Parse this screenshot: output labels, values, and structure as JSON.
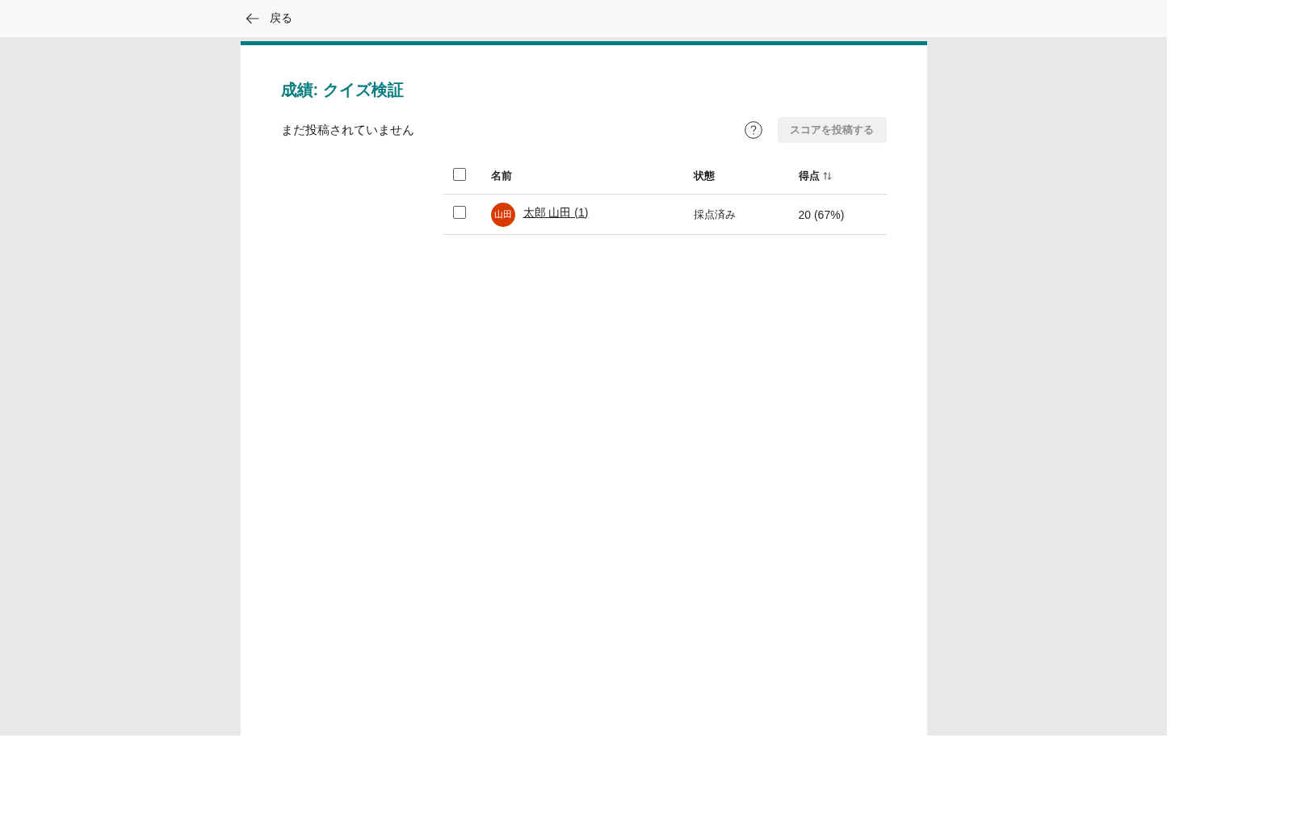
{
  "topbar": {
    "back_label": "戻る"
  },
  "page": {
    "title": "成績: クイズ検証",
    "status_text": "まだ投稿されていません",
    "post_button": {
      "label": "スコアを投稿する",
      "disabled": true
    }
  },
  "table": {
    "select_all": {
      "checked": false
    },
    "columns": [
      {
        "label": "名前",
        "sortable": false
      },
      {
        "label": "状態",
        "sortable": false
      },
      {
        "label": "得点",
        "sortable": true
      }
    ],
    "rows": [
      {
        "checked": false,
        "avatar": {
          "initials": "山田",
          "color": "#d83b01"
        },
        "name": "太郎 山田 (1)",
        "status": "採点済み",
        "score": "20 (67%)"
      }
    ]
  }
}
